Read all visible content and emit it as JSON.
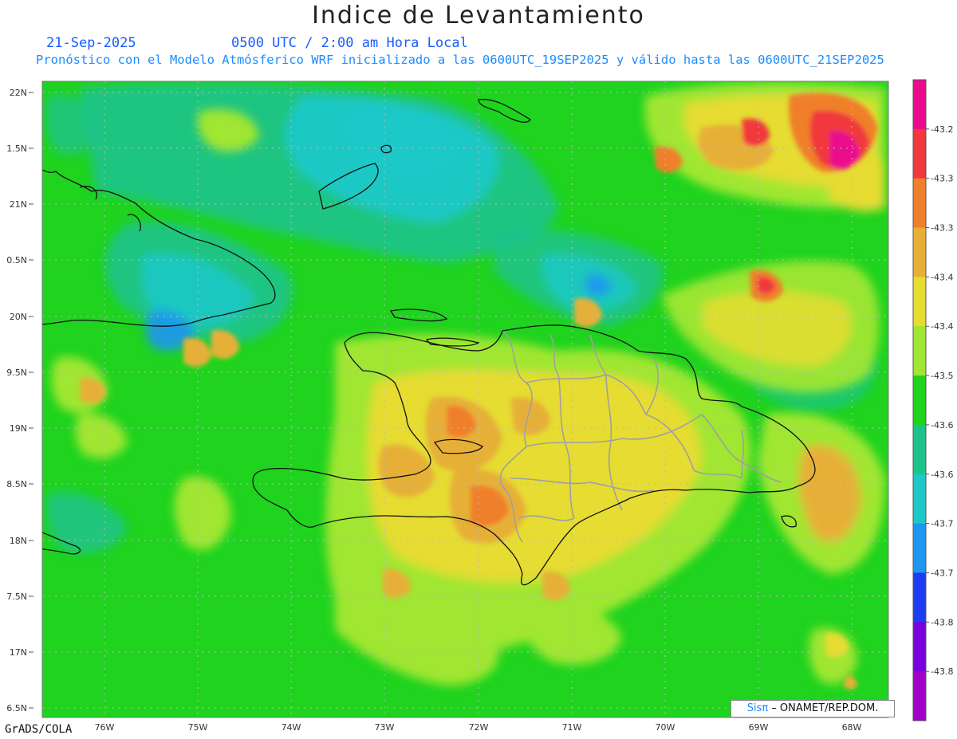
{
  "header": {
    "title": "Indice de Levantamiento",
    "date": "21-Sep-2025",
    "time": "0500 UTC / 2:00 am Hora Local",
    "forecast_note": "Pronóstico con el Modelo Atmósferico WRF inicializado a las 0600UTC_19SEP2025 y válido hasta las  0600UTC_21SEP2025"
  },
  "map": {
    "lon_labels": [
      "76W",
      "75W",
      "74W",
      "73W",
      "72W",
      "71W",
      "70W",
      "69W",
      "68W"
    ],
    "lat_labels": [
      "22N",
      "1.5N",
      "21N",
      "0.5N",
      "20N",
      "9.5N",
      "19N",
      "8.5N",
      "18N",
      "7.5N",
      "17N",
      "6.5N"
    ],
    "background_color": "#1fd31f"
  },
  "colorbar": {
    "labels": [
      "-43.2",
      "-43.3",
      "-43.3",
      "-43.4",
      "-43.4",
      "-43.5",
      "-43.6",
      "-43.6",
      "-43.7",
      "-43.7",
      "-43.8",
      "-43.8"
    ],
    "colors": [
      "#ea0c8c",
      "#f0383e",
      "#f07f2c",
      "#e6b038",
      "#e6dc32",
      "#a0e632",
      "#1fd31f",
      "#1ec38c",
      "#1ec8c8",
      "#1e96f0",
      "#1e3cf0",
      "#7800dc",
      "#a000c8"
    ]
  },
  "credit": {
    "brand": "Sisπ",
    "org": " – ONAMET/REP.DOM."
  },
  "footer": {
    "software": "GrADS/COLA"
  }
}
